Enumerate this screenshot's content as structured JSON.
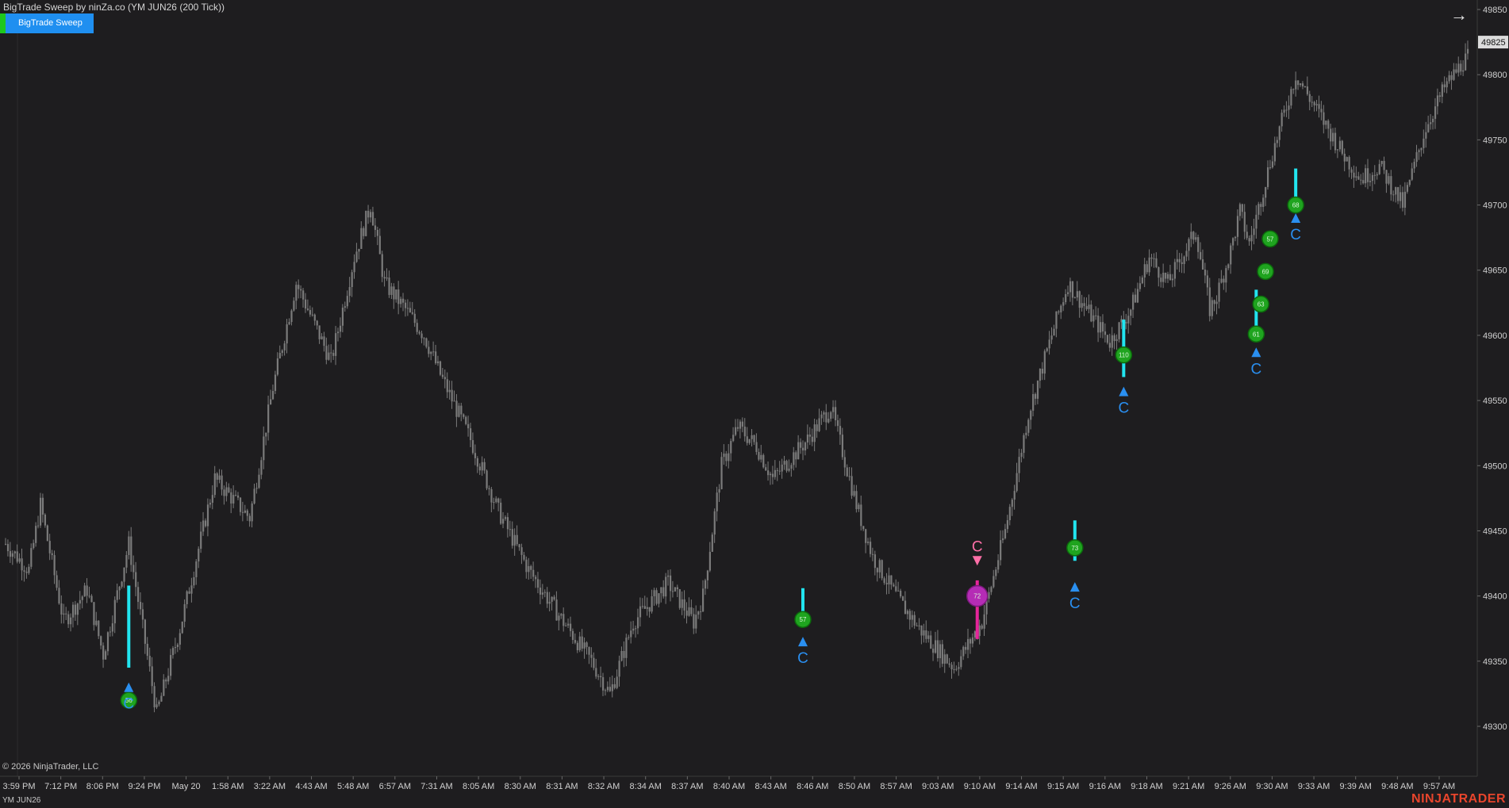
{
  "header": {
    "title": "BigTrade Sweep by ninZa.co (YM JUN26 (200 Tick))",
    "indicator_label": "BigTrade Sweep"
  },
  "footer": {
    "copyright": "© 2026 NinjaTrader, LLC",
    "instrument": "YM JUN26",
    "brand": "NINJATRADER"
  },
  "colors": {
    "background": "#1e1d1f",
    "candle": "#7b7b7b",
    "axis_text": "#d0d0d0",
    "buy_signal": "#2a8ff0",
    "sell_signal": "#ff6fa8",
    "buy_sweep_bar": "#22e5f0",
    "sell_sweep_bar": "#e5259a",
    "buy_bubble": "#1fa41f",
    "sell_bubble": "#b52cb5",
    "price_tag_bg": "#dcdcdc"
  },
  "chart_data": {
    "type": "candlestick",
    "instrument": "YM JUN26",
    "bar_type": "200 Tick",
    "last_price": 49825,
    "ylim": [
      49285,
      49865
    ],
    "y_ticks": [
      49300,
      49350,
      49400,
      49450,
      49500,
      49550,
      49600,
      49650,
      49700,
      49750,
      49800,
      49850
    ],
    "x_ticks": [
      "3:59 PM",
      "7:12 PM",
      "8:06 PM",
      "9:24 PM",
      "May 20",
      "1:58 AM",
      "3:22 AM",
      "4:43 AM",
      "5:48 AM",
      "6:57 AM",
      "7:31 AM",
      "8:05 AM",
      "8:30 AM",
      "8:31 AM",
      "8:32 AM",
      "8:34 AM",
      "8:37 AM",
      "8:40 AM",
      "8:43 AM",
      "8:46 AM",
      "8:50 AM",
      "8:57 AM",
      "9:03 AM",
      "9:10 AM",
      "9:14 AM",
      "9:15 AM",
      "9:16 AM",
      "9:18 AM",
      "9:21 AM",
      "9:26 AM",
      "9:30 AM",
      "9:33 AM",
      "9:39 AM",
      "9:48 AM",
      "9:57 AM"
    ],
    "price_path": [
      [
        0,
        49440
      ],
      [
        10,
        49420
      ],
      [
        15,
        49470
      ],
      [
        25,
        49380
      ],
      [
        35,
        49405
      ],
      [
        42,
        49355
      ],
      [
        53,
        49440
      ],
      [
        65,
        49310
      ],
      [
        75,
        49375
      ],
      [
        90,
        49490
      ],
      [
        105,
        49460
      ],
      [
        115,
        49560
      ],
      [
        125,
        49640
      ],
      [
        140,
        49580
      ],
      [
        150,
        49660
      ],
      [
        157,
        49700
      ],
      [
        163,
        49640
      ],
      [
        172,
        49620
      ],
      [
        180,
        49600
      ],
      [
        187,
        49570
      ],
      [
        200,
        49520
      ],
      [
        212,
        49465
      ],
      [
        225,
        49420
      ],
      [
        240,
        49380
      ],
      [
        252,
        49350
      ],
      [
        260,
        49325
      ],
      [
        270,
        49380
      ],
      [
        285,
        49410
      ],
      [
        296,
        49380
      ],
      [
        300,
        49400
      ],
      [
        308,
        49500
      ],
      [
        315,
        49530
      ],
      [
        323,
        49515
      ],
      [
        330,
        49490
      ],
      [
        345,
        49520
      ],
      [
        355,
        49545
      ],
      [
        366,
        49470
      ],
      [
        373,
        49430
      ],
      [
        383,
        49400
      ],
      [
        393,
        49375
      ],
      [
        408,
        49345
      ],
      [
        420,
        49380
      ],
      [
        430,
        49450
      ],
      [
        440,
        49540
      ],
      [
        450,
        49600
      ],
      [
        457,
        49640
      ],
      [
        475,
        49595
      ],
      [
        484,
        49620
      ],
      [
        492,
        49660
      ],
      [
        500,
        49640
      ],
      [
        512,
        49680
      ],
      [
        518,
        49620
      ],
      [
        521,
        49630
      ],
      [
        527,
        49665
      ],
      [
        531,
        49695
      ],
      [
        535,
        49670
      ],
      [
        545,
        49740
      ],
      [
        555,
        49800
      ],
      [
        565,
        49770
      ],
      [
        575,
        49740
      ],
      [
        583,
        49720
      ],
      [
        591,
        49730
      ],
      [
        601,
        49700
      ],
      [
        611,
        49760
      ],
      [
        619,
        49790
      ],
      [
        627,
        49810
      ],
      [
        636,
        49825
      ]
    ],
    "markers": [
      {
        "type": "buy",
        "label": "C",
        "index": 53,
        "price": 49330,
        "bubble_price": 49320,
        "bubble_text": "56",
        "bar_from": 49345,
        "bar_to": 49408
      },
      {
        "type": "buy",
        "label": "C",
        "index": 343,
        "price": 49365,
        "bubble_price": 49382,
        "bubble_text": "57",
        "bar_from": 49388,
        "bar_to": 49406
      },
      {
        "type": "sell",
        "label": "C",
        "index": 418,
        "price": 49427,
        "bubble_price": 49400,
        "bubble_text": "72",
        "bar_from": 49367,
        "bar_to": 49412
      },
      {
        "type": "buy",
        "label": "C",
        "index": 460,
        "price": 49407,
        "bubble_price": 49437,
        "bubble_text": "73",
        "bar_from": 49427,
        "bar_to": 49458
      },
      {
        "type": "buy",
        "label": "C",
        "index": 481,
        "price": 49557,
        "bubble_price": 49585,
        "bubble_text": "110",
        "bar_from": 49568,
        "bar_to": 49612
      },
      {
        "type": "buy",
        "label": "C",
        "index": 538,
        "price": 49587,
        "bubble_price": 49601,
        "bubble_text": "61",
        "bar_from": 49605,
        "bar_to": 49635
      },
      {
        "type": "buy",
        "label": null,
        "index": 540,
        "price": null,
        "bubble_price": 49624,
        "bubble_text": "63",
        "bar_from": null,
        "bar_to": null
      },
      {
        "type": "buy",
        "label": null,
        "index": 542,
        "price": null,
        "bubble_price": 49649,
        "bubble_text": "69",
        "bar_from": null,
        "bar_to": null
      },
      {
        "type": "buy",
        "label": null,
        "index": 544,
        "price": null,
        "bubble_price": 49674,
        "bubble_text": "57",
        "bar_from": null,
        "bar_to": null
      },
      {
        "type": "buy",
        "label": "C",
        "index": 555,
        "price": 49690,
        "bubble_price": 49700,
        "bubble_text": "68",
        "bar_from": 49700,
        "bar_to": 49728
      }
    ]
  }
}
